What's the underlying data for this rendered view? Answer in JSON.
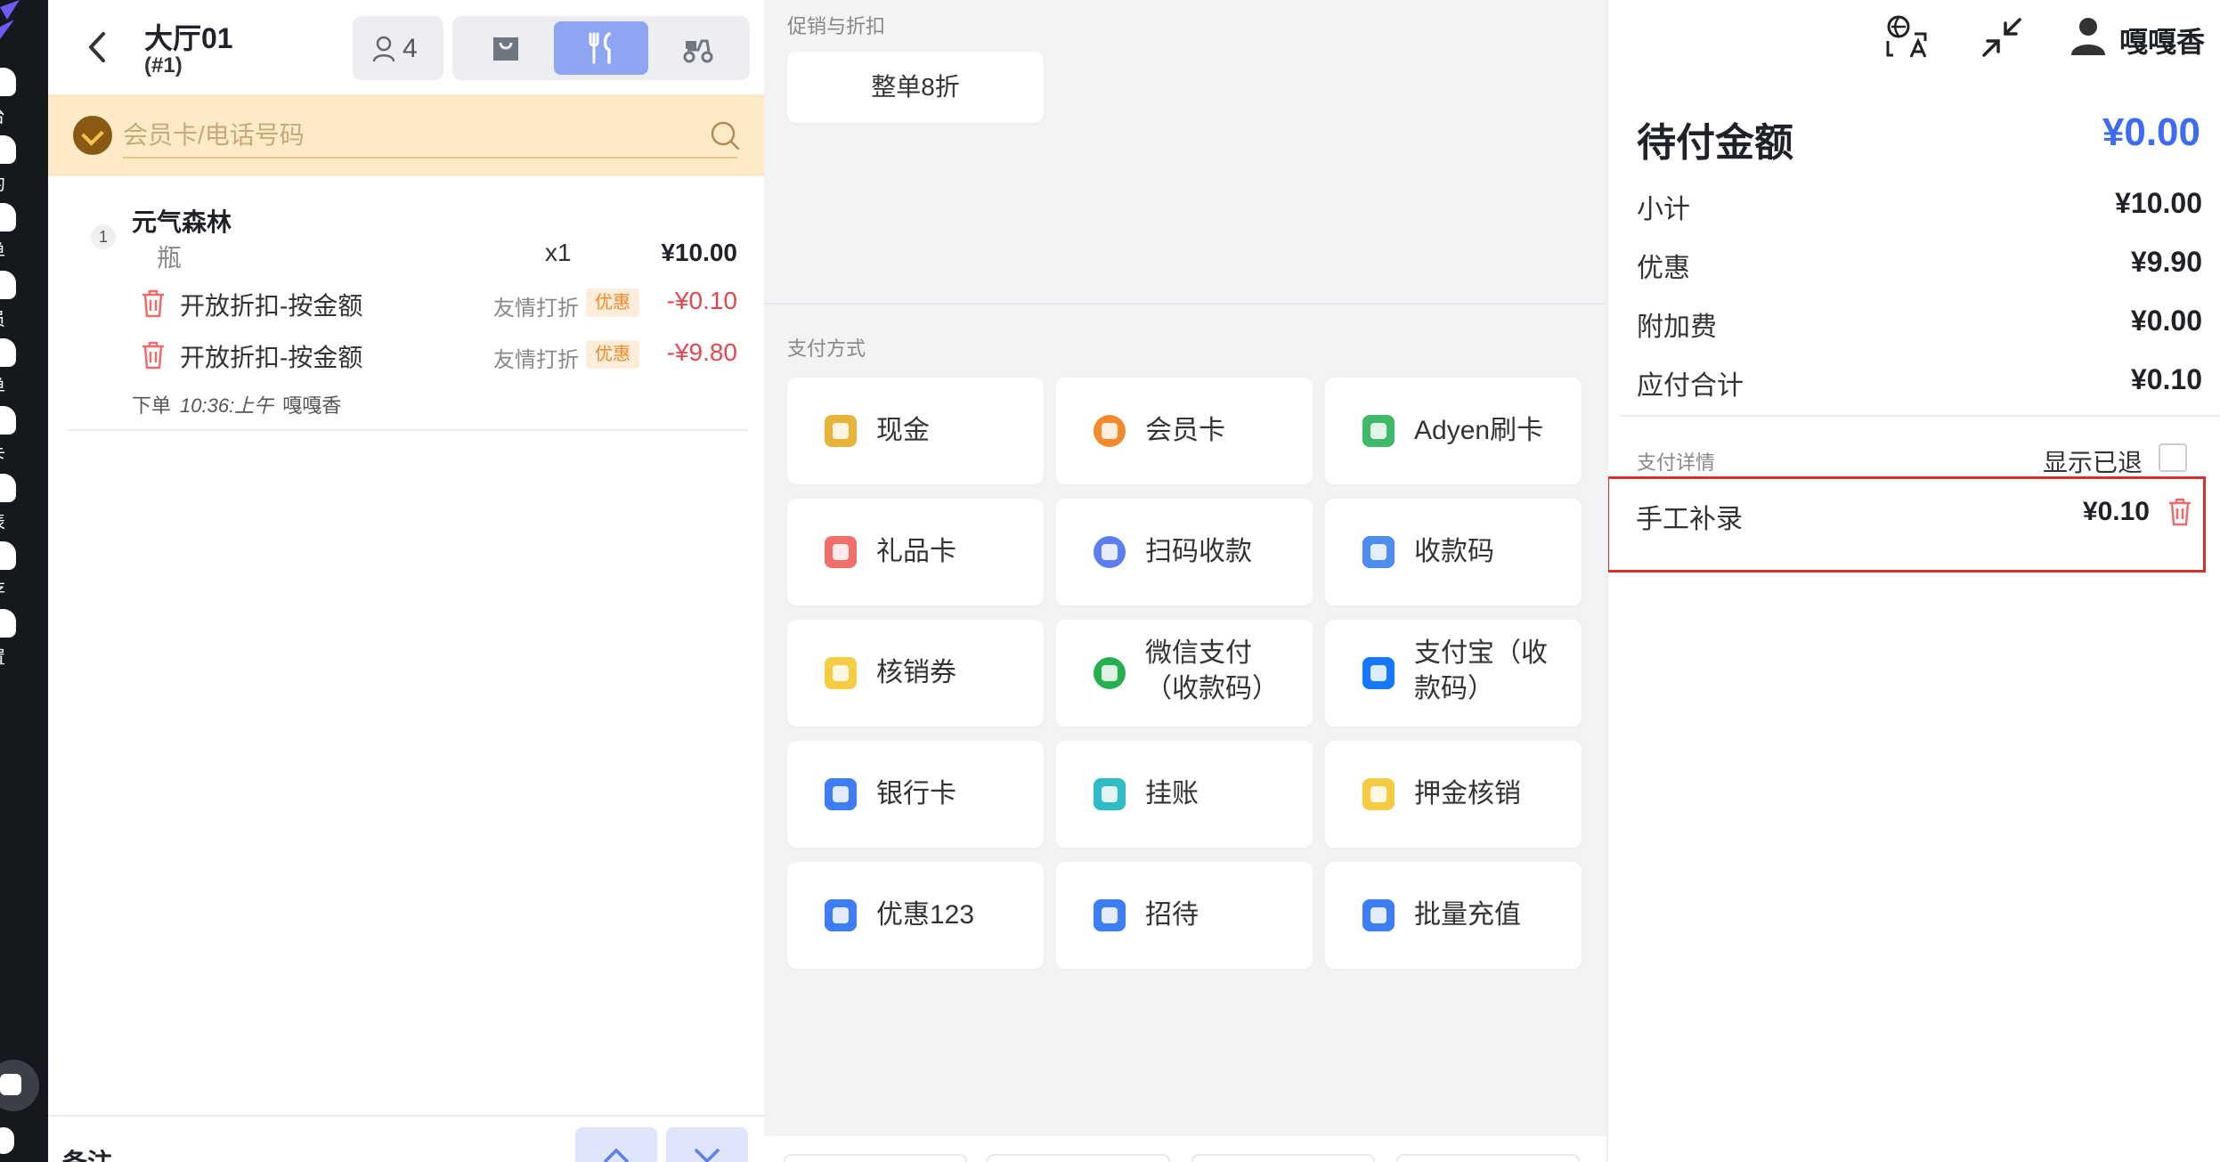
{
  "rail": {
    "items": [
      {
        "label": "台",
        "icon": "home-icon"
      },
      {
        "label": "约",
        "icon": "booking-icon"
      },
      {
        "label": "单",
        "icon": "order-icon"
      },
      {
        "label": "员",
        "icon": "staff-icon"
      },
      {
        "label": "单",
        "icon": "list-icon"
      },
      {
        "label": "卡",
        "icon": "card-icon"
      },
      {
        "label": "表",
        "icon": "report-icon"
      },
      {
        "label": "存",
        "icon": "storage-icon"
      },
      {
        "label": "置",
        "icon": "settings-icon"
      }
    ]
  },
  "order": {
    "table_name": "大厅01",
    "table_no": "(#1)",
    "guest_count": "4",
    "modes": [
      "takeout",
      "dine-in",
      "delivery"
    ],
    "active_mode": "dine-in",
    "member_placeholder": "会员卡/电话号码",
    "item": {
      "index": "1",
      "name": "元气森林",
      "unit": "瓶",
      "qty": "x1",
      "price": "¥10.00",
      "discounts": [
        {
          "name": "开放折扣-按金额",
          "reason": "友情打折",
          "tag": "优惠",
          "amount": "-¥0.10"
        },
        {
          "name": "开放折扣-按金额",
          "reason": "友情打折",
          "tag": "优惠",
          "amount": "-¥9.80"
        }
      ],
      "meta": {
        "label": "下单",
        "time": "10:36:上午",
        "user": "嘎嘎香"
      }
    },
    "remark_label": "备注"
  },
  "middle": {
    "promo_title": "促销与折扣",
    "promo_button": "整单8折",
    "payment_title": "支付方式",
    "payments": [
      {
        "label": "现金",
        "color": "#e7b53c"
      },
      {
        "label": "会员卡",
        "color": "#f28a2b"
      },
      {
        "label": "Adyen刷卡",
        "color": "#3fba6a"
      },
      {
        "label": "礼品卡",
        "color": "#ef6f6a"
      },
      {
        "label": "扫码收款",
        "color": "#5b7ef0"
      },
      {
        "label": "收款码",
        "color": "#4d8ef0"
      },
      {
        "label": "核销券",
        "color": "#f7cc45"
      },
      {
        "label": "微信支付（收款码）",
        "line1": "微信支付",
        "line2": "（收款码）",
        "color": "#22b14c"
      },
      {
        "label": "支付宝（收款码）",
        "color": "#1677ff"
      },
      {
        "label": "银行卡",
        "color": "#3d7ef5"
      },
      {
        "label": "挂账",
        "color": "#2fbcc4"
      },
      {
        "label": "押金核销",
        "color": "#f7cc45"
      },
      {
        "label": "优惠123",
        "color": "#3d7ef5"
      },
      {
        "label": "招待",
        "color": "#3d7ef5"
      },
      {
        "label": "批量充值",
        "color": "#3d7ef5"
      }
    ]
  },
  "payment": {
    "user_name": "嘎嘎香",
    "due_label": "待付金额",
    "due_amount": "¥0.00",
    "summary": [
      {
        "label": "小计",
        "value": "¥10.00"
      },
      {
        "label": "优惠",
        "value": "¥9.90"
      },
      {
        "label": "附加费",
        "value": "¥0.00"
      },
      {
        "label": "应付合计",
        "value": "¥0.10"
      }
    ],
    "detail_label": "支付详情",
    "show_refunded_label": "显示已退",
    "records": [
      {
        "name": "手工补录",
        "amount": "¥0.10"
      }
    ],
    "accent_color": "#3d6cf2",
    "highlight_color": "#d9302c"
  }
}
